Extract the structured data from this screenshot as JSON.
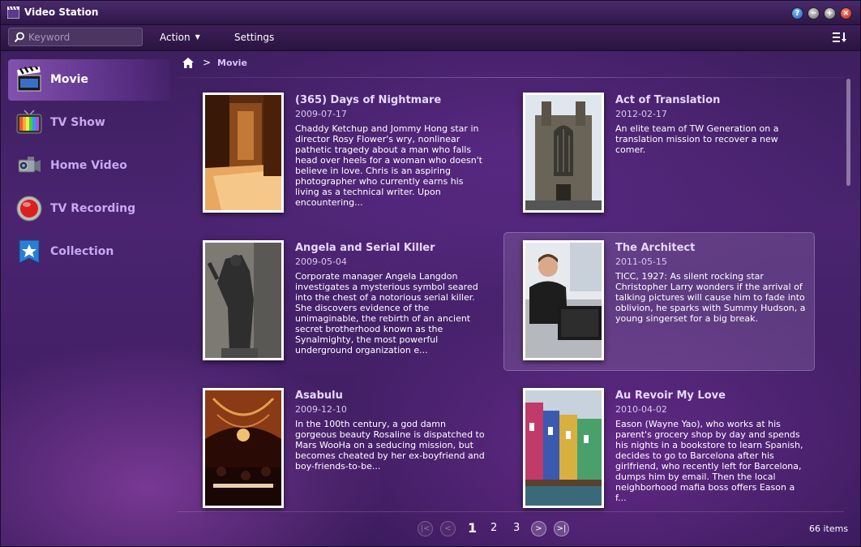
{
  "window": {
    "title": "Video Station"
  },
  "toolbar": {
    "search_placeholder": "Keyword",
    "action_label": "Action",
    "settings_label": "Settings"
  },
  "sidebar": {
    "items": [
      {
        "label": "Movie",
        "icon": "movie-clapper-icon",
        "active": true
      },
      {
        "label": "TV Show",
        "icon": "tv-show-icon",
        "active": false
      },
      {
        "label": "Home Video",
        "icon": "camcorder-icon",
        "active": false
      },
      {
        "label": "TV Recording",
        "icon": "record-icon",
        "active": false
      },
      {
        "label": "Collection",
        "icon": "star-collection-icon",
        "active": false
      }
    ]
  },
  "breadcrumb": {
    "separator": ">",
    "current": "Movie"
  },
  "movies": [
    {
      "title": "(365) Days of Nightmare",
      "date": "2009-07-17",
      "description": "Chaddy Ketchup and Jommy Hong star in director Rosy Flower's wry, nonlinear pathetic tragedy about a man who falls head over heels for a woman who doesn't believe in love. Chris is an aspiring photographer who currently earns his living as a technical writer. Upon encountering..."
    },
    {
      "title": "Act of Translation",
      "date": "2012-02-17",
      "description": "An elite team of TW Generation on a translation mission to recover a new comer."
    },
    {
      "title": "Angela and Serial Killer",
      "date": "2009-05-04",
      "description": "Corporate manager Angela Langdon investigates a mysterious symbol seared into the chest of a notorious serial killer. She discovers evidence of the unimaginable, the rebirth of an ancient secret brotherhood known as the Synalmighty, the most powerful underground organization e..."
    },
    {
      "title": "The Architect",
      "date": "2011-05-15",
      "description": "TICC, 1927: As silent rocking star Christopher Larry wonders if the arrival of talking pictures will cause him to fade into oblivion, he sparks with Summy Hudson, a young singerset for a big break."
    },
    {
      "title": "Asabulu",
      "date": "2009-12-10",
      "description": "In the 100th century, a god damn gorgeous beauty Rosaline is dispatched to Mars WooHa on a seducing mission, but becomes cheated by her ex-boyfriend and boy-friends-to-be..."
    },
    {
      "title": "Au Revoir My Love",
      "date": "2010-04-02",
      "description": "Eason (Wayne Yao), who works at his parent's grocery shop by day and spends his nights in a bookstore to learn Spanish, decides to go to Barcelona after his girlfriend, who recently left for Barcelona, dumps him by email. Then the local neighborhood mafia boss offers Eason a f..."
    }
  ],
  "pagination": {
    "pages": [
      "1",
      "2",
      "3"
    ],
    "current_page": "1",
    "item_count": "66 items"
  },
  "colors": {
    "accent": "#c7a9f2",
    "background": "#3a1d5a"
  }
}
